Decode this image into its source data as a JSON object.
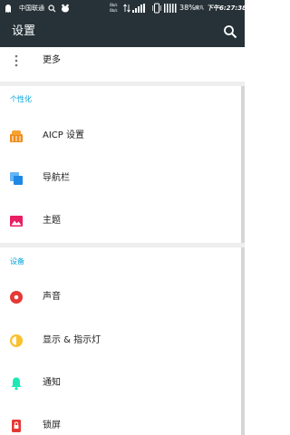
{
  "status_bar": {
    "carrier": "中国联通",
    "net_speed_up": "0b/s",
    "net_speed_down": "0b/s",
    "battery_percent": "38%",
    "tag": "魔丸",
    "time": "下午6:27:38"
  },
  "app_bar": {
    "title": "设置",
    "search_icon": "search-icon"
  },
  "items": {
    "more": {
      "label": "更多",
      "icon": "more-vert-icon"
    }
  },
  "sections": [
    {
      "header": "个性化",
      "items": [
        {
          "label": "AICP 设置",
          "icon": "aicp-icon",
          "color": "#ef8c1a"
        },
        {
          "label": "导航栏",
          "icon": "navigation-bar-icon",
          "color": "#2196f3"
        },
        {
          "label": "主题",
          "icon": "theme-icon",
          "color": "#e91e63"
        }
      ]
    },
    {
      "header": "设备",
      "items": [
        {
          "label": "声音",
          "icon": "sound-icon",
          "color": "#e53935"
        },
        {
          "label": "显示 & 指示灯",
          "icon": "display-icon",
          "color": "#fbc02d"
        },
        {
          "label": "通知",
          "icon": "notification-bell-icon",
          "color": "#1de9b6"
        },
        {
          "label": "锁屏",
          "icon": "lock-screen-icon",
          "color": "#e53935"
        }
      ]
    }
  ],
  "colors": {
    "toolbar": "#263238",
    "accent": "#00a3d9",
    "divider": "#eeeeee"
  }
}
